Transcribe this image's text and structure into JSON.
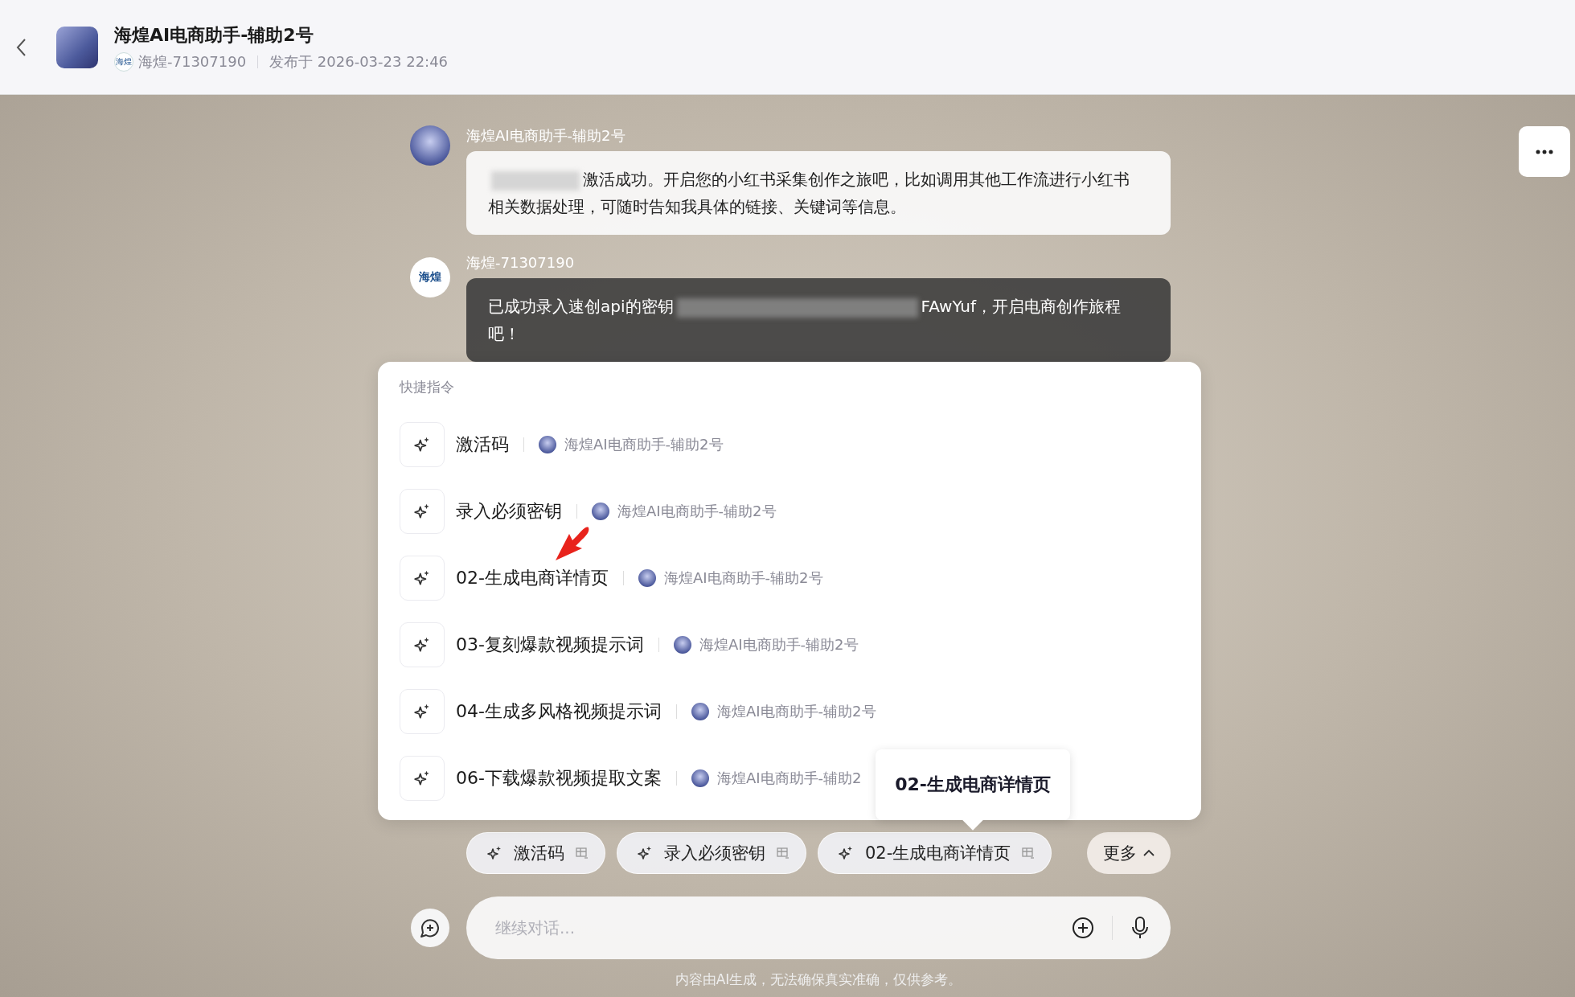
{
  "header": {
    "title": "海煌AI电商助手-辅助2号",
    "author_avatar_text": "海煌",
    "author": "海煌-71307190",
    "published": "发布于 2026-03-23 22:46"
  },
  "messages": [
    {
      "kind": "bot",
      "sender": "海煌AI电商助手-辅助2号",
      "segments": [
        {
          "kind": "redacted"
        },
        {
          "kind": "text",
          "text": "激活成功。开启您的小红书采集创作之旅吧，比如调用其他工作流进行小红书相关数据处理，可随时告知我具体的链接、关键词等信息。"
        }
      ]
    },
    {
      "kind": "user",
      "sender": "海煌-71307190",
      "avatar_text": "海煌",
      "segments": [
        {
          "kind": "text",
          "text": "已成功录入速创api的密钥"
        },
        {
          "kind": "redacted"
        },
        {
          "kind": "text",
          "text": "FAwYuf，开启电商创作旅程吧！"
        }
      ]
    }
  ],
  "quick_commands": {
    "title": "快捷指令",
    "items": [
      {
        "label": "激活码",
        "bot": "海煌AI电商助手-辅助2号"
      },
      {
        "label": "录入必须密钥",
        "bot": "海煌AI电商助手-辅助2号"
      },
      {
        "label": "02-生成电商详情页",
        "bot": "海煌AI电商助手-辅助2号"
      },
      {
        "label": "03-复刻爆款视频提示词",
        "bot": "海煌AI电商助手-辅助2号"
      },
      {
        "label": "04-生成多风格视频提示词",
        "bot": "海煌AI电商助手-辅助2号"
      },
      {
        "label": "06-下载爆款视频提取文案",
        "bot": "海煌AI电商助手-辅助2"
      }
    ]
  },
  "tooltip": "02-生成电商详情页",
  "chips": [
    {
      "label": "激活码"
    },
    {
      "label": "录入必须密钥"
    },
    {
      "label": "02-生成电商详情页"
    }
  ],
  "more_button": "更多",
  "input": {
    "placeholder": "继续对话..."
  },
  "disclaimer": "内容由AI生成，无法确保真实准确，仅供参考。"
}
